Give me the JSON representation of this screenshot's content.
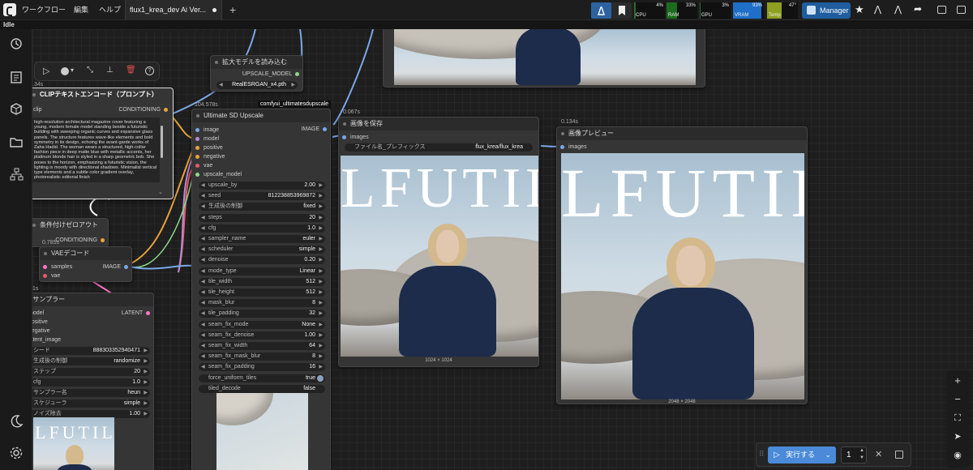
{
  "menu": {
    "workflow": "ワークフロー",
    "edit": "編集",
    "help": "ヘルプ"
  },
  "tab": {
    "label": "flux1_krea_dev Ai Ver..."
  },
  "status": {
    "idle": "Idle"
  },
  "meters": [
    {
      "name": "CPU",
      "pct": "4%",
      "value": 0.04,
      "color": "#2d6b2d"
    },
    {
      "name": "RAM",
      "pct": "33%",
      "value": 0.33,
      "color": "#1d6b1d"
    },
    {
      "name": "GPU",
      "pct": "3%",
      "value": 0.03,
      "color": "#2d6b2d"
    },
    {
      "name": "VRAM",
      "pct": "93%",
      "value": 0.93,
      "color": "#1f6fc8"
    },
    {
      "name": "Temp",
      "pct": "47°",
      "value": 0.47,
      "color": "#8f9f1f"
    }
  ],
  "manager_label": "Manager",
  "nodes": {
    "upscale_model_loader": {
      "title": "拡大モデルを読み込む",
      "output": "UPSCALE_MODEL",
      "value": "RealESRGAN_x4.pth"
    },
    "clip": {
      "badge": ".34s",
      "title": "CLIPテキストエンコード（プロンプト）",
      "input": "clip",
      "output": "CONDITIONING",
      "text": "high-resolution architectural magazine cover featuring a young, modern female model standing beside a futuristic building with sweeping organic curves and expansive glass panels. The structure features wave-like elements and bold symmetry in its design, echoing the avant-garde works of Zaha Hadid. The woman wears a structured, high-collar fashion piece in deep matte blue with metallic accents, her platinum blonde hair is styled in a sharp geometric bob. She poses to the horizon, emphasizing a futuristic vision, the lighting is moody with directional shadows. Minimalist vertical type elements and a subtle color gradient overlay, photorealistic editorial finish"
    },
    "zero_out": {
      "title": "条件付けゼロアウト",
      "output": "CONDITIONING"
    },
    "vae_decode": {
      "badge": "0.785s",
      "title": "VAEデコード",
      "inputs": [
        "samples",
        "vae"
      ],
      "output": "IMAGE"
    },
    "ksampler": {
      "badge": "1s",
      "title": "Kサンプラー",
      "output": "LATENT",
      "inputs": [
        "model",
        "positive",
        "negative",
        "latent_image"
      ],
      "widgets": [
        {
          "label": "シード",
          "value": "888303352940471"
        },
        {
          "label": "生成後の制御",
          "value": "randomize"
        },
        {
          "label": "ステップ",
          "value": "20"
        },
        {
          "label": "cfg",
          "value": "1.0"
        },
        {
          "label": "サンプラー名",
          "value": "heun"
        },
        {
          "label": "スケジューラ",
          "value": "simple"
        },
        {
          "label": "ノイズ除去",
          "value": "1.00"
        }
      ]
    },
    "ultimate": {
      "badge": "104.578s",
      "tag": "comfyui_ultimatesdupscale",
      "title": "Ultimate SD Upscale",
      "output": "IMAGE",
      "inputs": [
        "image",
        "model",
        "positive",
        "negative",
        "vae",
        "upscale_model"
      ],
      "widgets": [
        {
          "label": "upscale_by",
          "value": "2.00"
        },
        {
          "label": "seed",
          "value": "812238853969872"
        },
        {
          "label": "生成後の制御",
          "value": "fixed"
        },
        {
          "label": "steps",
          "value": "20"
        },
        {
          "label": "cfg",
          "value": "1.0"
        },
        {
          "label": "sampler_name",
          "value": "euler"
        },
        {
          "label": "scheduler",
          "value": "simple"
        },
        {
          "label": "denoise",
          "value": "0.20"
        },
        {
          "label": "mode_type",
          "value": "Linear"
        },
        {
          "label": "tile_width",
          "value": "512"
        },
        {
          "label": "tile_height",
          "value": "512"
        },
        {
          "label": "mask_blur",
          "value": "8"
        },
        {
          "label": "tile_padding",
          "value": "32"
        },
        {
          "label": "seam_fix_mode",
          "value": "None"
        },
        {
          "label": "seam_fix_denoise",
          "value": "1.00"
        },
        {
          "label": "seam_fix_width",
          "value": "64"
        },
        {
          "label": "seam_fix_mask_blur",
          "value": "8"
        },
        {
          "label": "seam_fix_padding",
          "value": "16"
        },
        {
          "label": "force_uniform_tiles",
          "value": "true"
        },
        {
          "label": "tiled_decode",
          "value": "false"
        }
      ]
    },
    "save": {
      "badge": "0.067s",
      "title": "画像を保存",
      "input": "images",
      "prefix_label": "ファイル名_プレフィックス",
      "prefix_value": "flux_krea/flux_krea",
      "size": "1024 × 1024"
    },
    "preview": {
      "badge": "0.134s",
      "title": "画像プレビュー",
      "input": "images",
      "size": "2048 × 2048"
    }
  },
  "magazine": {
    "title": "LFUTILI"
  },
  "run": {
    "label": "実行する",
    "count": "1"
  }
}
